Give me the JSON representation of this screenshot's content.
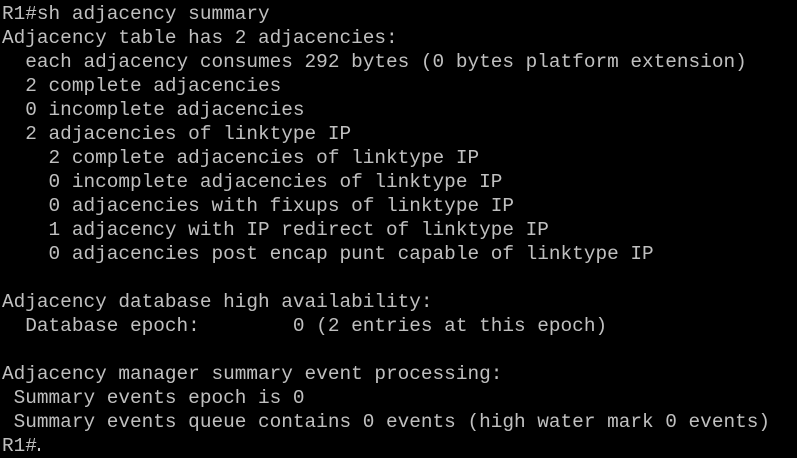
{
  "terminal": {
    "colors": {
      "background": "#000000",
      "foreground": "#c0c0c0"
    },
    "lines": [
      "R1#sh adjacency summary",
      "Adjacency table has 2 adjacencies:",
      "  each adjacency consumes 292 bytes (0 bytes platform extension)",
      "  2 complete adjacencies",
      "  0 incomplete adjacencies",
      "  2 adjacencies of linktype IP",
      "    2 complete adjacencies of linktype IP",
      "    0 incomplete adjacencies of linktype IP",
      "    0 adjacencies with fixups of linktype IP",
      "    1 adjacency with IP redirect of linktype IP",
      "    0 adjacencies post encap punt capable of linktype IP",
      "",
      "Adjacency database high availability:",
      "  Database epoch:        0 (2 entries at this epoch)",
      "",
      "Adjacency manager summary event processing:",
      " Summary events epoch is 0",
      " Summary events queue contains 0 events (high water mark 0 events)"
    ],
    "prompt": "R1#"
  }
}
